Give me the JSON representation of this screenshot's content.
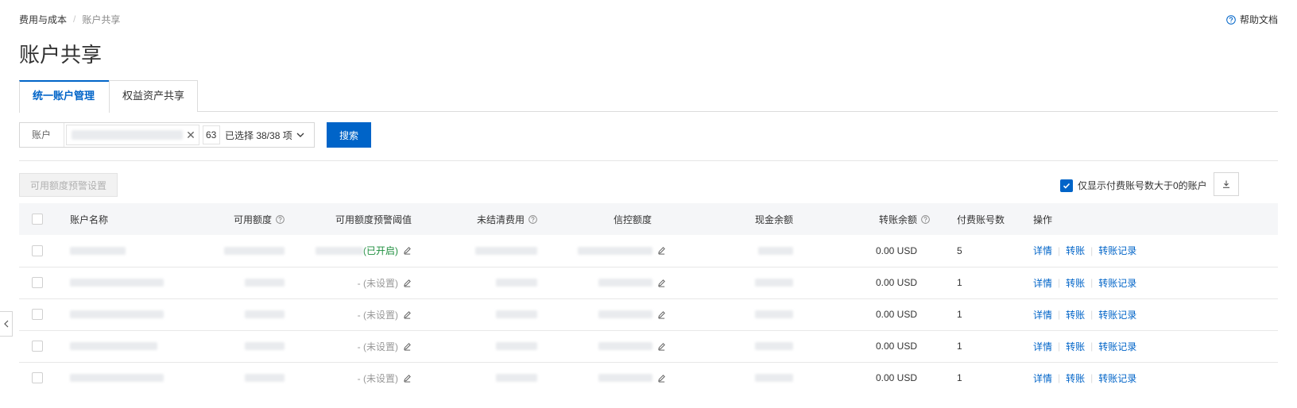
{
  "breadcrumb": {
    "root": "费用与成本",
    "separator": "/",
    "current": "账户共享"
  },
  "help": {
    "label": "帮助文档"
  },
  "page_title": "账户共享",
  "tabs": [
    {
      "label": "统一账户管理",
      "active": true
    },
    {
      "label": "权益资产共享",
      "active": false
    }
  ],
  "filter": {
    "label": "账户",
    "count_prefix": "63",
    "selected_label": "已选择 38/38 项",
    "search_button": "搜索"
  },
  "toolbar": {
    "threshold_button": "可用额度预警设置",
    "only_show_label": "仅显示付费账号数大于0的账户",
    "only_show_checked": true
  },
  "table": {
    "columns": {
      "name": "账户名称",
      "available": "可用额度",
      "threshold": "可用额度预警阈值",
      "unsettled": "未结清费用",
      "credit": "信控额度",
      "cash": "现金余额",
      "transfer": "转账余额",
      "payer_count": "付费账号数",
      "actions": "操作"
    },
    "rows": [
      {
        "threshold_status": "(已开启)",
        "transfer_balance": "0.00 USD",
        "payer_count": "5"
      },
      {
        "threshold_status": "- (未设置)",
        "transfer_balance": "0.00 USD",
        "payer_count": "1"
      },
      {
        "threshold_status": "- (未设置)",
        "transfer_balance": "0.00 USD",
        "payer_count": "1"
      },
      {
        "threshold_status": "- (未设置)",
        "transfer_balance": "0.00 USD",
        "payer_count": "1"
      },
      {
        "threshold_status": "- (未设置)",
        "transfer_balance": "0.00 USD",
        "payer_count": "1"
      }
    ],
    "actions": {
      "detail": "详情",
      "transfer": "转账",
      "transfer_record": "转账记录"
    }
  },
  "colors": {
    "accent": "#0064c8",
    "enabled_status": "#1e8e3e"
  }
}
